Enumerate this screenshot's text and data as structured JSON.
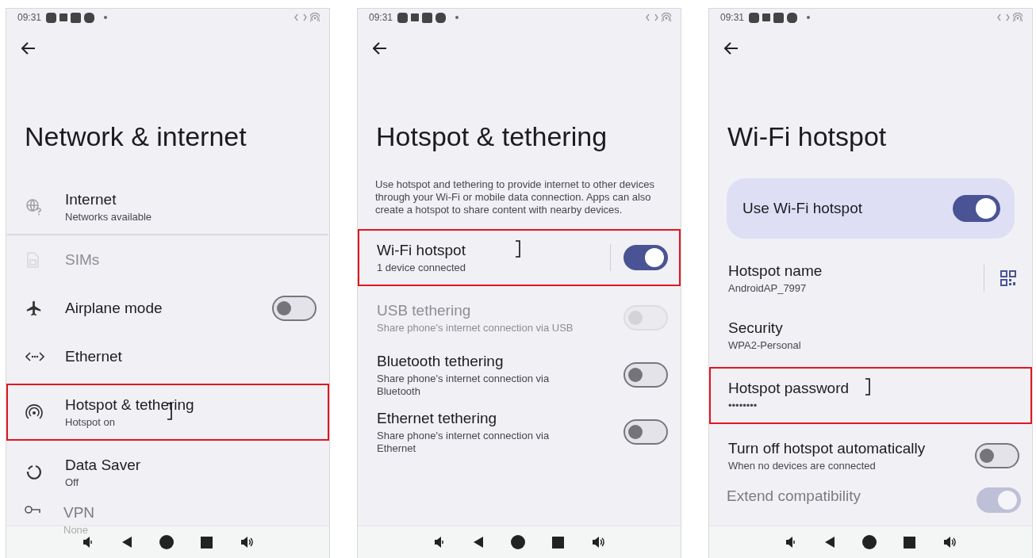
{
  "screens": [
    {
      "status_bar": {
        "time": "09:31"
      },
      "title": "Network & internet",
      "items": [
        {
          "kind": "plain",
          "title": "Internet",
          "subtitle": "Networks available",
          "divider": true
        },
        {
          "kind": "plain",
          "title": "SIMs",
          "disabled": true
        },
        {
          "kind": "toggle",
          "title": "Airplane mode",
          "on": false
        },
        {
          "kind": "plain",
          "title": "Ethernet"
        },
        {
          "kind": "plain",
          "title": "Hotspot & tethering",
          "subtitle": "Hotspot on",
          "highlighted": true,
          "cursor": true
        },
        {
          "kind": "plain",
          "title": "Data Saver",
          "subtitle": "Off"
        },
        {
          "kind": "partial",
          "title": "VPN",
          "subtitle": "None"
        }
      ]
    },
    {
      "status_bar": {
        "time": "09:31"
      },
      "title": "Hotspot & tethering",
      "items": [
        {
          "kind": "note",
          "title": "Use hotspot and tethering to provide internet to other devices through your Wi-Fi or mobile data connection. Apps can also create a hotspot to share content with nearby devices."
        },
        {
          "kind": "toggle",
          "title": "Wi-Fi hotspot",
          "subtitle": "1 device connected",
          "highlighted": true,
          "cursor": true,
          "on": true,
          "separator": true
        },
        {
          "kind": "toggle",
          "title": "USB tethering",
          "subtitle": "Share phone's internet connection via USB",
          "disabled": true,
          "on": false
        },
        {
          "kind": "toggle",
          "title": "Bluetooth tethering",
          "subtitle": "Share phone's internet connection via Bluetooth",
          "on": false
        },
        {
          "kind": "toggle",
          "title": "Ethernet tethering",
          "subtitle": "Share phone's internet connection via Ethernet",
          "on": false
        }
      ]
    },
    {
      "status_bar": {
        "time": "09:31"
      },
      "title": "Wi-Fi hotspot",
      "items": [
        {
          "kind": "card",
          "title": "Use Wi-Fi hotspot",
          "on": true
        },
        {
          "kind": "qr",
          "title": "Hotspot name",
          "subtitle": "AndroidAP_7997",
          "separator": true
        },
        {
          "kind": "plain",
          "title": "Security",
          "subtitle": "WPA2-Personal"
        },
        {
          "kind": "plain",
          "title": "Hotspot password",
          "subtitle": "••••••••",
          "highlighted": true,
          "cursor": true
        },
        {
          "kind": "toggle",
          "title": "Turn off hotspot automatically",
          "subtitle": "When no devices are connected",
          "on": false
        },
        {
          "kind": "partial",
          "title": "Extend compatibility",
          "on": true
        }
      ]
    }
  ]
}
